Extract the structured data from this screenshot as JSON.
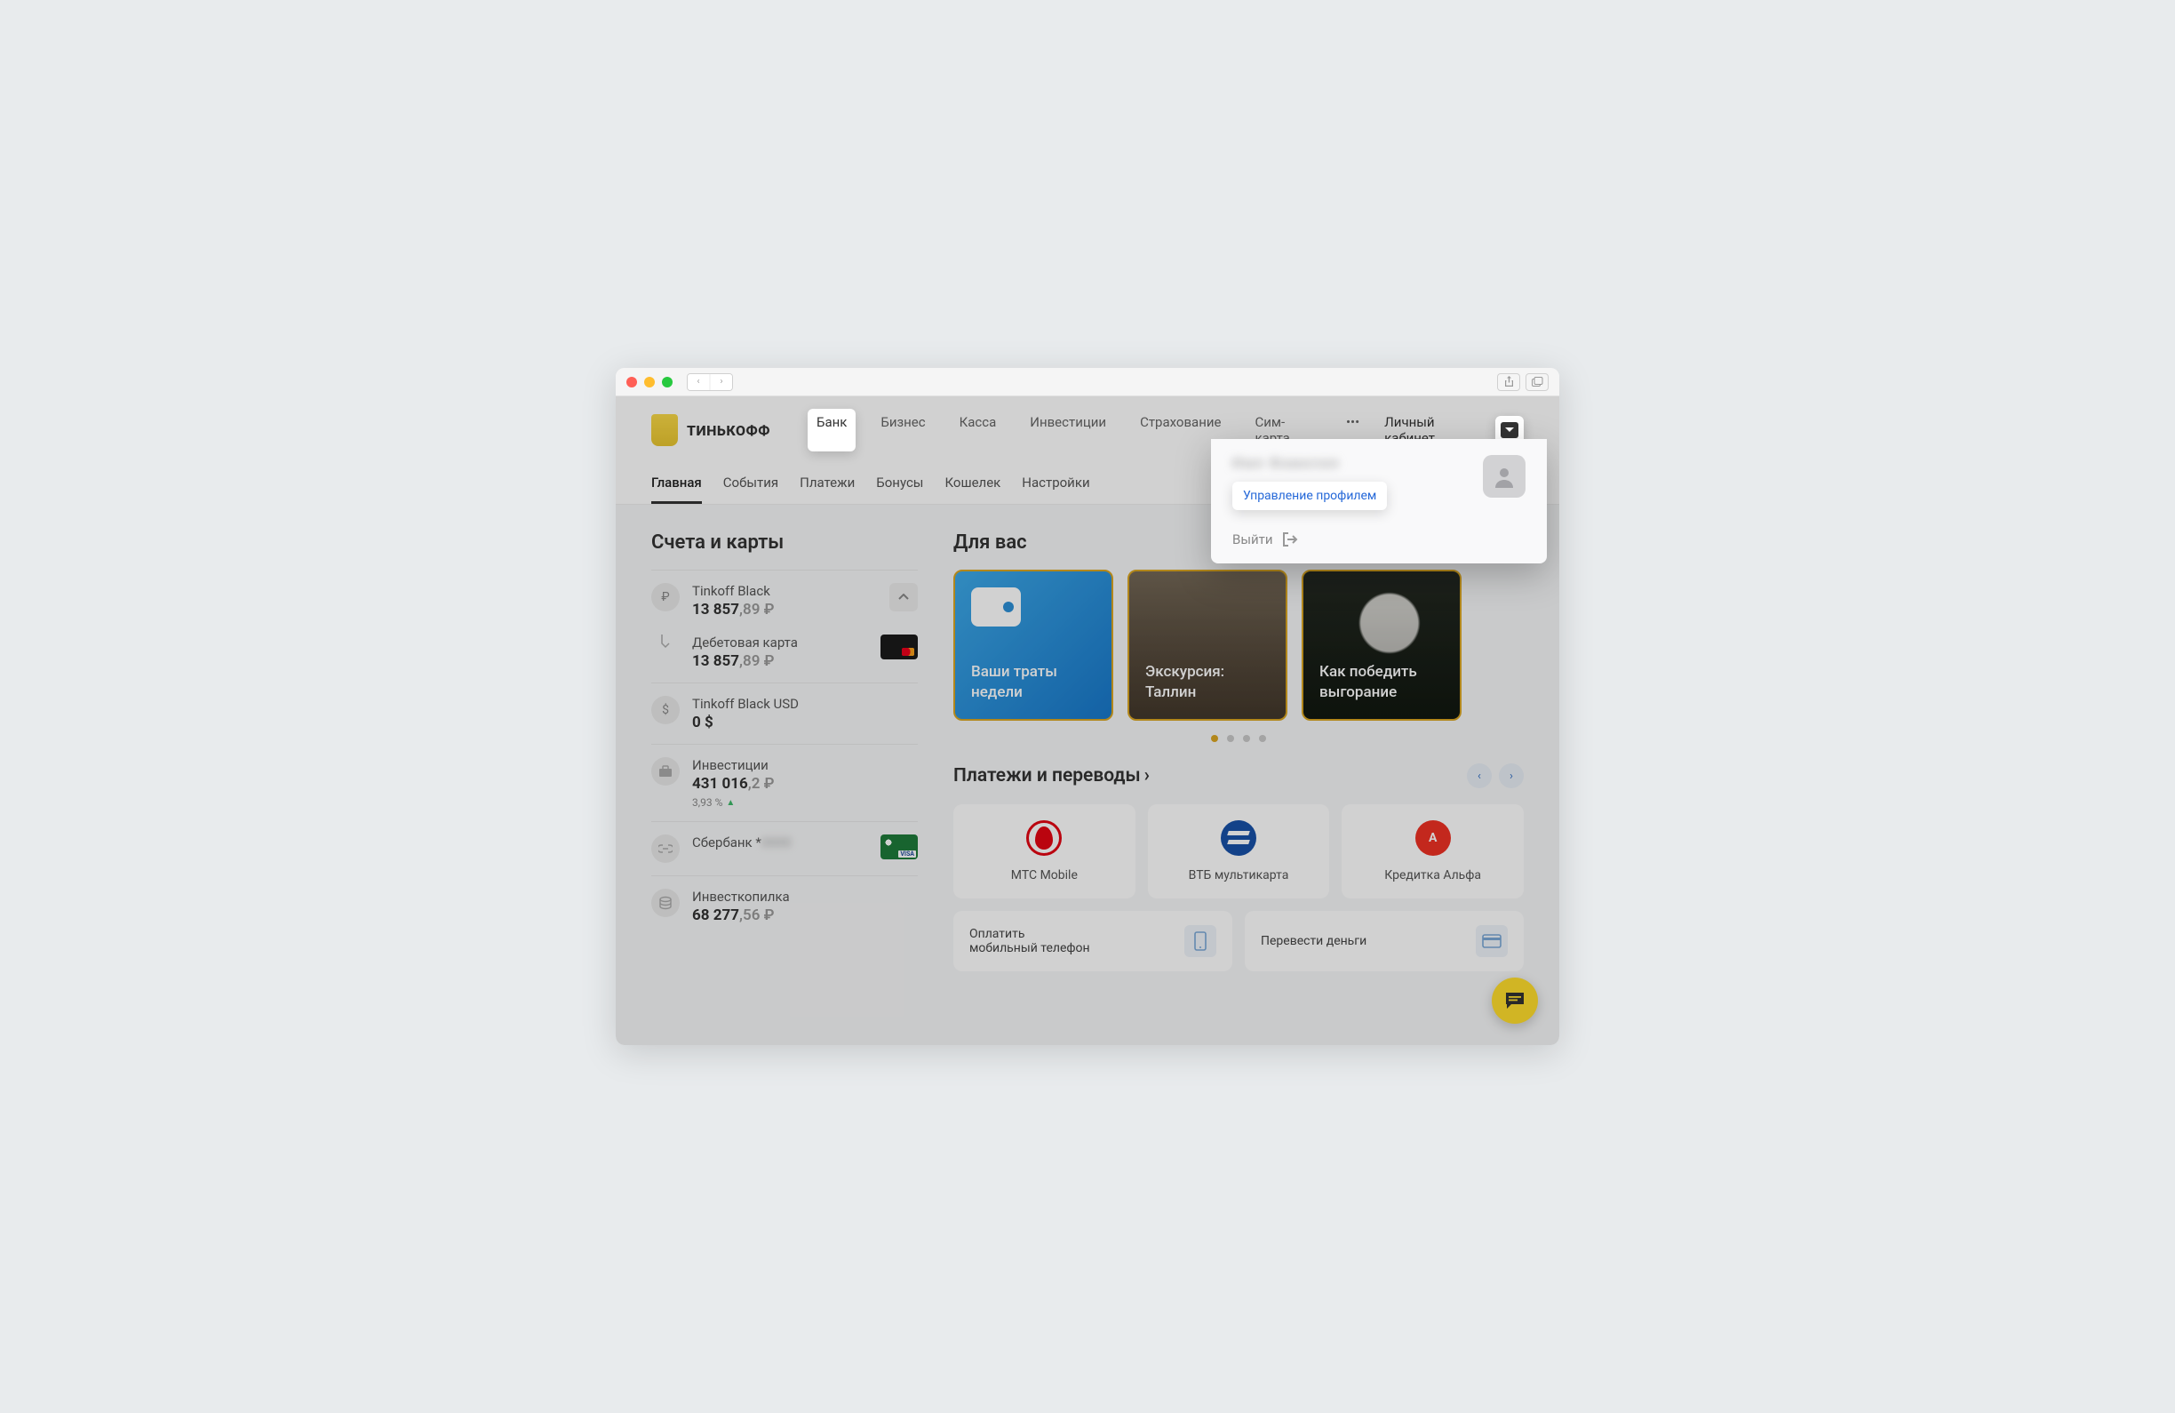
{
  "logo_text": "ТИНЬКОФФ",
  "top_nav": [
    "Банк",
    "Бизнес",
    "Касса",
    "Инвестиции",
    "Страхование",
    "Сим-карта"
  ],
  "account_label": "Личный кабинет",
  "subnav": [
    "Главная",
    "События",
    "Платежи",
    "Бонусы",
    "Кошелек",
    "Настройки"
  ],
  "sidebar": {
    "title": "Счета и карты",
    "accounts": [
      {
        "name": "Tinkoff Black",
        "balance_int": "13 857",
        "balance_frac": ",89 ₽"
      },
      {
        "name": "Дебетовая карта",
        "balance_int": "13 857",
        "balance_frac": ",89 ₽"
      },
      {
        "name": "Tinkoff Black USD",
        "balance_int": "0 $",
        "balance_frac": ""
      },
      {
        "name": "Инвестиции",
        "balance_int": "431 016",
        "balance_frac": ",2 ₽",
        "change": "3,93 %"
      },
      {
        "name": "Сбербанк *",
        "balance_int": "",
        "balance_frac": ""
      },
      {
        "name": "Инвесткопилка",
        "balance_int": "68 277",
        "balance_frac": ",56 ₽"
      }
    ]
  },
  "for_you": {
    "title": "Для вас",
    "cards": [
      "Ваши траты недели",
      "Экскурсия: Таллин",
      "Как победить выгорание"
    ]
  },
  "payments": {
    "title": "Платежи и переводы",
    "tiles": [
      "МТС Mobile",
      "ВТБ мультикарта",
      "Кредитка Альфа"
    ],
    "actions": [
      "Оплатить мобильный телефон",
      "Перевести деньги"
    ]
  },
  "dropdown": {
    "name": "Имя Фамилия",
    "manage": "Управление профилем",
    "logout": "Выйти"
  },
  "alfa_letter": "A"
}
